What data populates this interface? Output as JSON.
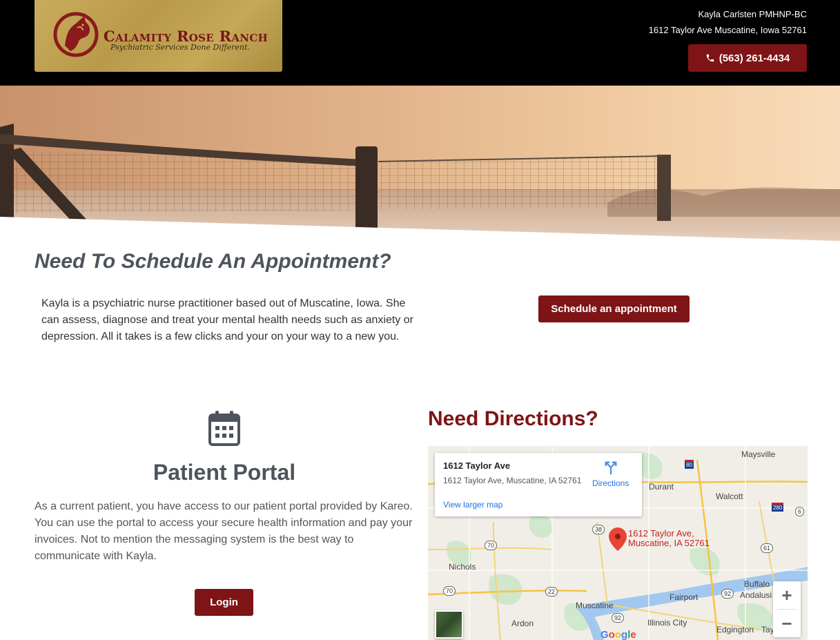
{
  "header": {
    "logo_name": "Calamity Rose Ranch",
    "logo_tagline": "Psychiatric Services Done Different.",
    "provider_name": "Kayla Carlsten PMHNP-BC",
    "address": "1612 Taylor Ave Muscatine, Iowa 52761",
    "phone_label": "(563) 261-4434",
    "phone_icon": "phone-icon"
  },
  "schedule": {
    "heading": "Need To Schedule An Appointment?",
    "text": "Kayla is a psychiatric nurse practitioner based out of Muscatine, Iowa. She can assess, diagnose and treat your mental health needs such as anxiety or depression. All it takes is a few clicks and your on your way to a new you.",
    "button_label": "Schedule an appointment"
  },
  "portal": {
    "icon": "calendar-icon",
    "heading": "Patient Portal",
    "text": "As a current patient, you have access to our patient portal provided by Kareo. You can use the portal to access your secure health information and pay your invoices. Not to mention the messaging system is the best way to communicate with Kayla.",
    "button_label": "Login"
  },
  "directions": {
    "heading": "Need Directions?",
    "map": {
      "card_title": "1612 Taylor Ave",
      "card_address": "1612 Taylor Ave, Muscatine, IA 52761",
      "directions_label": "Directions",
      "larger_map_label": "View larger map",
      "pin_label_line1": "1612 Taylor Ave,",
      "pin_label_line2": "Muscatine, IA 52761",
      "zoom_in": "+",
      "zoom_out": "−",
      "places": [
        "Maysville",
        "Durant",
        "Walcott",
        "Nichols",
        "Fairport",
        "Muscatine",
        "Buffalo",
        "Andalusi",
        "Ardon",
        "Illinois City",
        "Edgington",
        "Tay"
      ],
      "route_shields": [
        "80",
        "280",
        "6",
        "38",
        "70",
        "61",
        "22",
        "70",
        "92",
        "92"
      ],
      "google_label": "Google"
    }
  },
  "colors": {
    "brand_red": "#7e1416",
    "heading_gray": "#4e545c",
    "header_bg": "#000000",
    "logo_gold": "#c2a453"
  }
}
